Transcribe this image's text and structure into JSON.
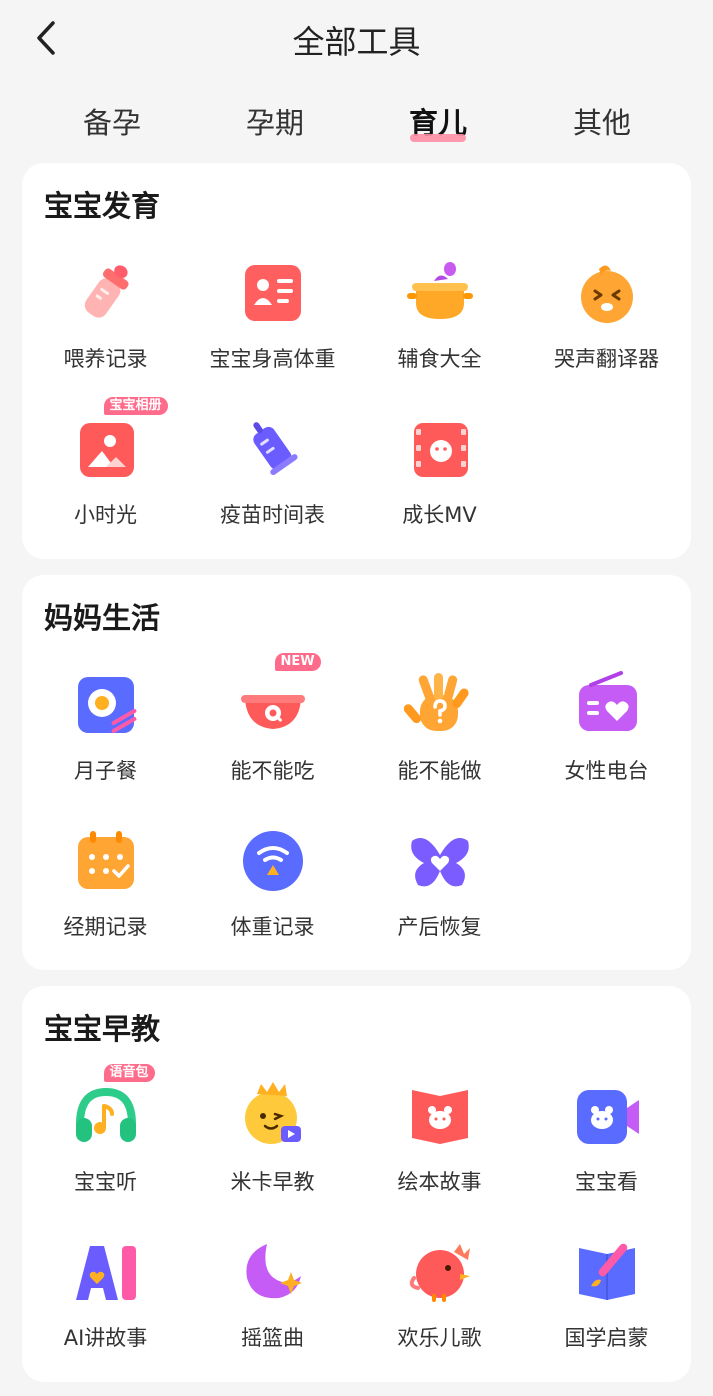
{
  "header": {
    "title": "全部工具"
  },
  "tabs": [
    {
      "label": "备孕"
    },
    {
      "label": "孕期"
    },
    {
      "label": "育儿"
    },
    {
      "label": "其他"
    }
  ],
  "active_tab": "育儿",
  "sections": [
    {
      "title": "宝宝发育",
      "tools": [
        {
          "label": "喂养记录",
          "icon": "bottle-icon"
        },
        {
          "label": "宝宝身高体重",
          "icon": "id-card-icon"
        },
        {
          "label": "辅食大全",
          "icon": "pot-icon"
        },
        {
          "label": "哭声翻译器",
          "icon": "crying-face-icon"
        },
        {
          "label": "小时光",
          "icon": "photo-album-icon",
          "badge": "宝宝相册"
        },
        {
          "label": "疫苗时间表",
          "icon": "vaccine-icon"
        },
        {
          "label": "成长MV",
          "icon": "film-icon"
        }
      ]
    },
    {
      "title": "妈妈生活",
      "tools": [
        {
          "label": "月子餐",
          "icon": "meal-icon"
        },
        {
          "label": "能不能吃",
          "icon": "bowl-icon",
          "badge": "NEW"
        },
        {
          "label": "能不能做",
          "icon": "hand-question-icon"
        },
        {
          "label": "女性电台",
          "icon": "radio-icon"
        },
        {
          "label": "经期记录",
          "icon": "calendar-icon"
        },
        {
          "label": "体重记录",
          "icon": "scale-icon"
        },
        {
          "label": "产后恢复",
          "icon": "butterfly-icon"
        }
      ]
    },
    {
      "title": "宝宝早教",
      "tools": [
        {
          "label": "宝宝听",
          "icon": "headphones-icon",
          "badge": "语音包"
        },
        {
          "label": "米卡早教",
          "icon": "mascot-icon"
        },
        {
          "label": "绘本故事",
          "icon": "picture-book-icon"
        },
        {
          "label": "宝宝看",
          "icon": "video-camera-icon"
        },
        {
          "label": "AI讲故事",
          "icon": "ai-icon"
        },
        {
          "label": "摇篮曲",
          "icon": "moon-icon"
        },
        {
          "label": "欢乐儿歌",
          "icon": "bird-icon"
        },
        {
          "label": "国学启蒙",
          "icon": "brush-book-icon"
        }
      ]
    }
  ],
  "colors": {
    "accent": "#ff8fa5",
    "badge": "#ff6b8a",
    "background": "#f5f5f5",
    "card": "#ffffff"
  }
}
